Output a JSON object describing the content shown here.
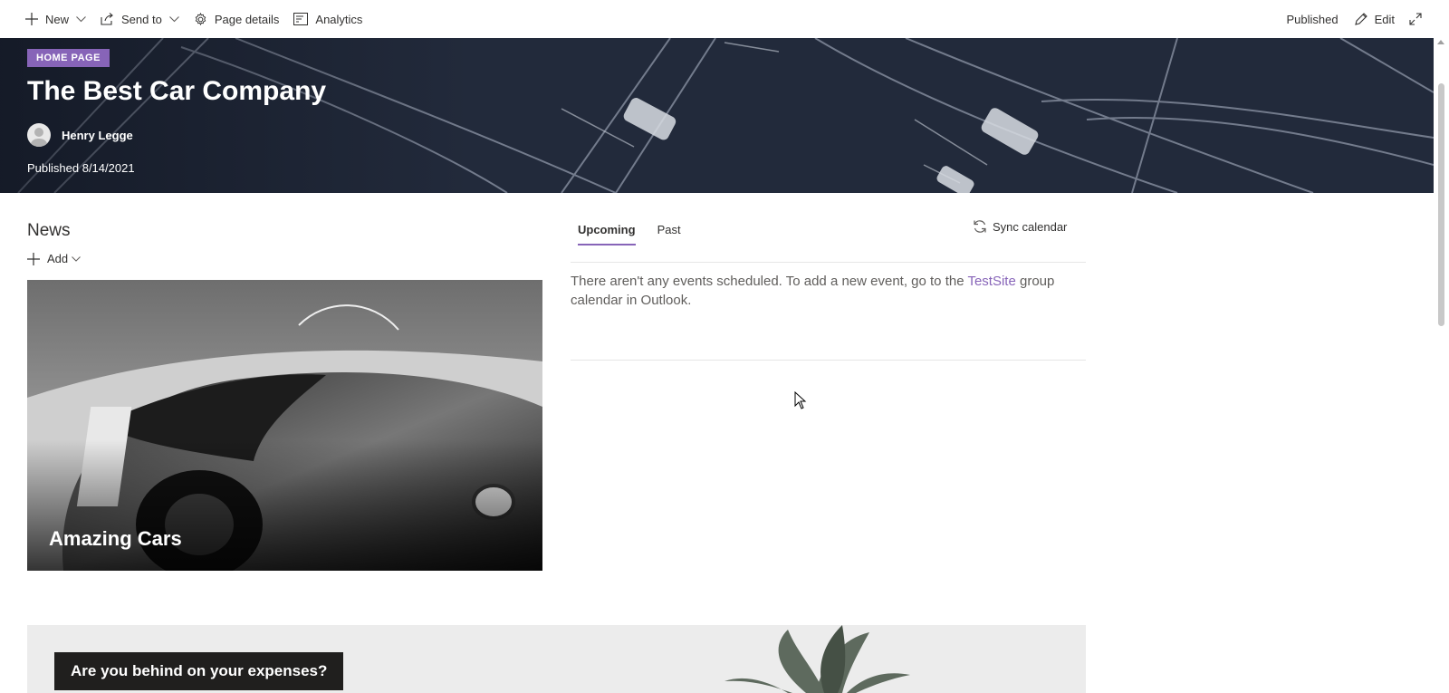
{
  "commandbar": {
    "new_label": "New",
    "send_label": "Send to",
    "details_label": "Page details",
    "analytics_label": "Analytics",
    "status": "Published",
    "edit_label": "Edit"
  },
  "hero": {
    "badge": "HOME PAGE",
    "title": "The Best Car Company",
    "author": "Henry Legge",
    "published": "Published 8/14/2021"
  },
  "news": {
    "title": "News",
    "add_label": "Add",
    "card_title": "Amazing Cars"
  },
  "events": {
    "tabs": [
      {
        "label": "Upcoming",
        "active": true
      },
      {
        "label": "Past",
        "active": false
      }
    ],
    "sync_label": "Sync calendar",
    "message_before": "There aren't any events scheduled. To add a new event, go to the ",
    "message_link": "TestSite",
    "message_after": " group calendar in Outlook."
  },
  "banner": {
    "text": "Are you behind on your expenses?"
  },
  "colors": {
    "accent": "#8764b8",
    "text": "#323130",
    "muted": "#605e5c"
  },
  "icons": [
    "plus-icon",
    "share-icon",
    "gear-icon",
    "analytics-icon",
    "pencil-icon",
    "expand-icon",
    "sync-icon",
    "chevron-down-icon",
    "person-icon"
  ]
}
